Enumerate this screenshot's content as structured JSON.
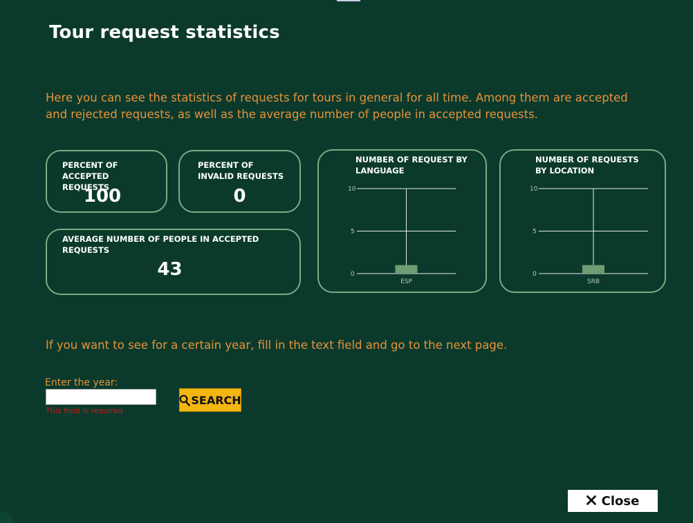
{
  "window": {
    "title": "Tour request statistics"
  },
  "intro_text": "Here you can see the statistics of requests for tours in general for all time. Among them are accepted and rejected requests, as well as the average number of people in accepted requests.",
  "stats": {
    "accepted": {
      "label": "PERCENT OF ACCEPTED REQUESTS",
      "value": "100"
    },
    "invalid": {
      "label": "PERCENT OF INVALID REQUESTS",
      "value": "0"
    },
    "people": {
      "label": "AVERAGE NUMBER OF PEOPLE IN ACCEPTED REQUESTS",
      "value": "43"
    }
  },
  "chart_data": [
    {
      "type": "bar",
      "title": "NUMBER OF REQUEST BY LANGUAGE",
      "categories": [
        "ESP"
      ],
      "values": [
        1
      ],
      "ylim": [
        0,
        10
      ],
      "yticks": [
        0,
        5,
        10
      ],
      "grid": true,
      "bar_color": "#6e9c73"
    },
    {
      "type": "bar",
      "title": "NUMBER OF REQUESTS BY LOCATION",
      "categories": [
        "SRB"
      ],
      "values": [
        1
      ],
      "ylim": [
        0,
        10
      ],
      "yticks": [
        0,
        5,
        10
      ],
      "grid": true,
      "bar_color": "#6e9c73"
    }
  ],
  "helper_text": "If you want to see for a certain year, fill in the text field and go to the next page.",
  "year_field": {
    "label": "Enter the year:",
    "value": "",
    "placeholder": "",
    "error": "This field is required"
  },
  "buttons": {
    "search": "SEARCH",
    "close": "Close"
  },
  "colors": {
    "background": "#0b3a2c",
    "accent": "#e8923a",
    "card_border": "#7fa984",
    "search_bg": "#f2b511",
    "error": "#d01818"
  },
  "icons": {
    "search": "magnifier-icon",
    "close": "x-icon"
  }
}
